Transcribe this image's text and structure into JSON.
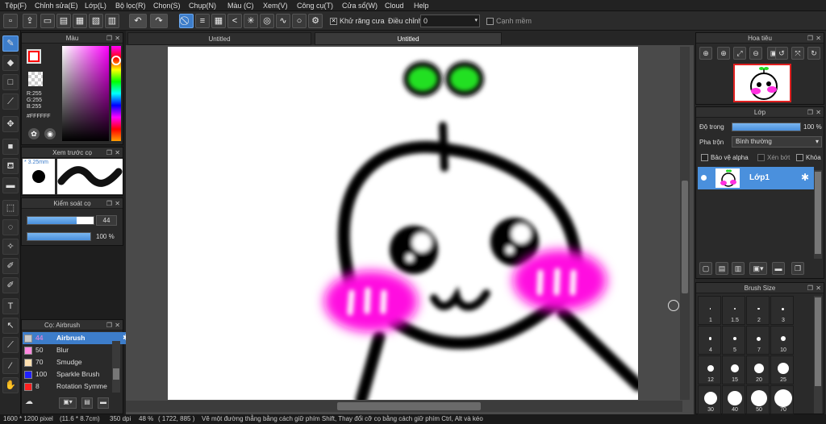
{
  "menu": [
    "Tệp(F)",
    "Chỉnh sửa(E)",
    "Lớp(L)",
    "Bộ lọc(R)",
    "Chọn(S)",
    "Chụp(N)",
    "Màu (C)",
    "Xem(V)",
    "Công cụ(T)",
    "Cửa sổ(W)",
    "Cloud",
    "Help"
  ],
  "toolbar": {
    "antialias_label": "Khử răng cưa",
    "correction_label": "Điều chỉnh",
    "correction_value": "0",
    "edge_label": "Cạnh mềm"
  },
  "tabs": [
    "Untitled",
    "Untitled"
  ],
  "color_panel": {
    "title": "Màu",
    "r": "R:255",
    "g": "G:255",
    "b": "B:255",
    "hex": "#FFFFFF",
    "primary_color": "#ff0000",
    "secondary_color": "#ffffff"
  },
  "preview_panel": {
    "title": "Xem trước cọ",
    "size": "* 3.25mm"
  },
  "brush_control": {
    "title": "Kiểm soát cọ",
    "size_value": "44",
    "opacity_value": "100 %",
    "size_fraction": 0.74,
    "opacity_fraction": 1.0
  },
  "brush_list": {
    "title": "Cọ: Airbrush",
    "items": [
      {
        "size": "44",
        "name": "Airbrush",
        "color": "#c8c8c8"
      },
      {
        "size": "50",
        "name": "Blur",
        "color": "#ff88e0"
      },
      {
        "size": "70",
        "name": "Smudge",
        "color": "#ffe0b0"
      },
      {
        "size": "100",
        "name": "Sparkle Brush",
        "color": "#2020ff"
      },
      {
        "size": "8",
        "name": "Rotation Symme",
        "color": "#ff2020"
      }
    ]
  },
  "navigator": {
    "title": "Hoa tiêu"
  },
  "layers": {
    "title": "Lớp",
    "opacity_label": "Độ trong",
    "opacity_value": "100 %",
    "opacity_fraction": 1.0,
    "blend_label": "Pha trộn",
    "blend_value": "Bình thường",
    "protect_alpha": "Bảo vệ alpha",
    "clipping": "Xén bớt",
    "lock": "Khóa",
    "layer_name": "Lớp1"
  },
  "brush_size": {
    "title": "Brush Size",
    "labels": [
      "1",
      "1.5",
      "2",
      "3",
      "4",
      "5",
      "7",
      "10",
      "12",
      "15",
      "20",
      "25",
      "30",
      "40",
      "50",
      "70"
    ]
  },
  "status": {
    "dims": "1600 * 1200 pixel",
    "physical": "(11.6 * 8.7cm)",
    "dpi": "350 dpi",
    "zoom": "48 %",
    "coords": "( 1722, 885 )",
    "hint": "Vẽ một đường thẳng bằng cách giữ phím Shift, Thay đổi cỡ cọ bằng cách giữ phím Ctrl, Alt và kéo"
  }
}
